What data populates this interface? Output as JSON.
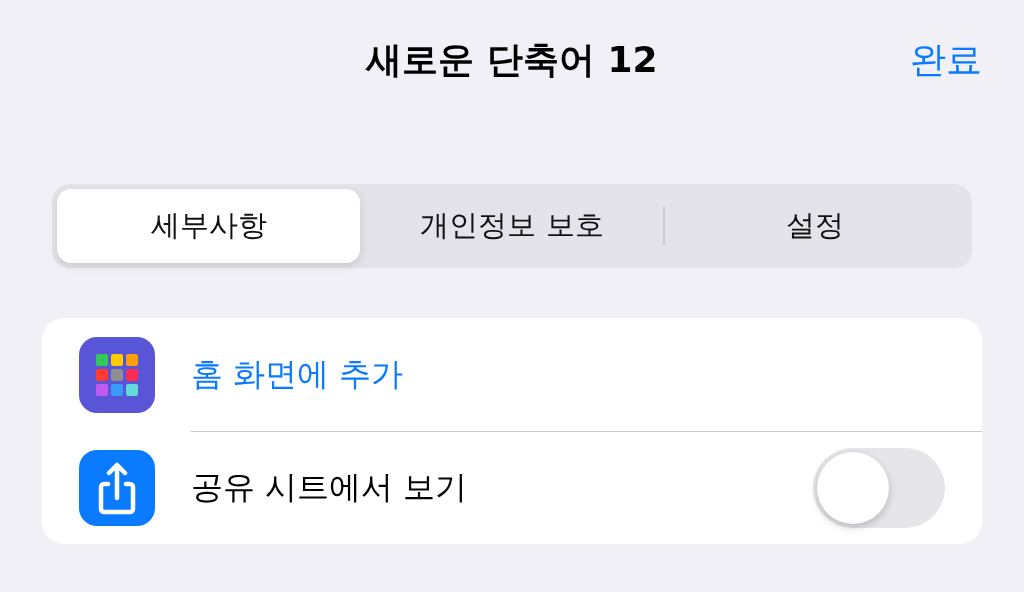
{
  "header": {
    "title": "새로운 단축어 12",
    "done": "완료"
  },
  "tabs": [
    {
      "label": "세부사항",
      "selected": true
    },
    {
      "label": "개인정보 보호",
      "selected": false
    },
    {
      "label": "설정",
      "selected": false
    }
  ],
  "rows": [
    {
      "kind": "action",
      "label": "홈 화면에 추가"
    },
    {
      "kind": "toggle",
      "label": "공유 시트에서 보기",
      "on": false
    }
  ]
}
